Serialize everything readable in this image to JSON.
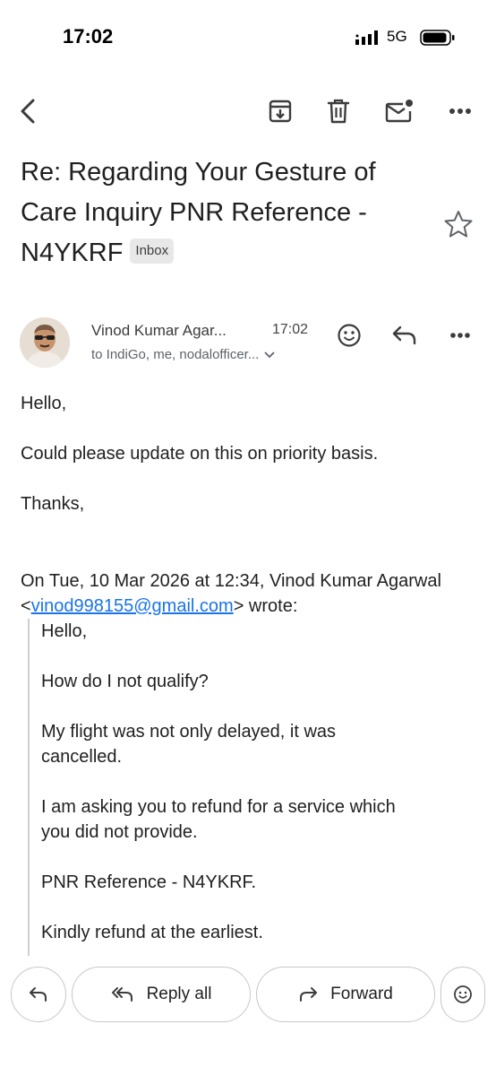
{
  "status_bar": {
    "time": "17:02",
    "network": "5G"
  },
  "toolbar": {
    "icons": [
      "back-arrow-icon",
      "archive-icon",
      "delete-icon",
      "mark-unread-icon",
      "more-icon"
    ]
  },
  "email": {
    "subject": "Re: Regarding Your Gesture of Care Inquiry PNR Reference - N4YKRF",
    "label": "Inbox",
    "sender_name": "Vinod Kumar Agar...",
    "time": "17:02",
    "recipients": "to IndiGo, me, nodalofficer...",
    "body": {
      "greeting": "Hello,",
      "line1": "Could please update on this on priority basis.",
      "closing": "Thanks,"
    },
    "quote_header": {
      "prefix": "On Tue, 10 Mar 2026 at 12:34, Vinod Kumar Agarwal <",
      "email": "vinod998155@gmail.com",
      "suffix": "> wrote:"
    },
    "quoted": {
      "p1": "Hello,",
      "p2": "How do I not qualify?",
      "p3a": "My flight was not only delayed, it was",
      "p3b": "cancelled.",
      "p4a": "I am asking you to refund for a service which",
      "p4b": "you did not provide.",
      "p5": "PNR Reference - N4YKRF.",
      "p6": "Kindly refund at the earliest."
    }
  },
  "actions": {
    "reply_all": "Reply all",
    "forward": "Forward"
  },
  "colors": {
    "link": "#1a73e8",
    "text": "#1f1f1f",
    "muted": "#5f6368"
  }
}
